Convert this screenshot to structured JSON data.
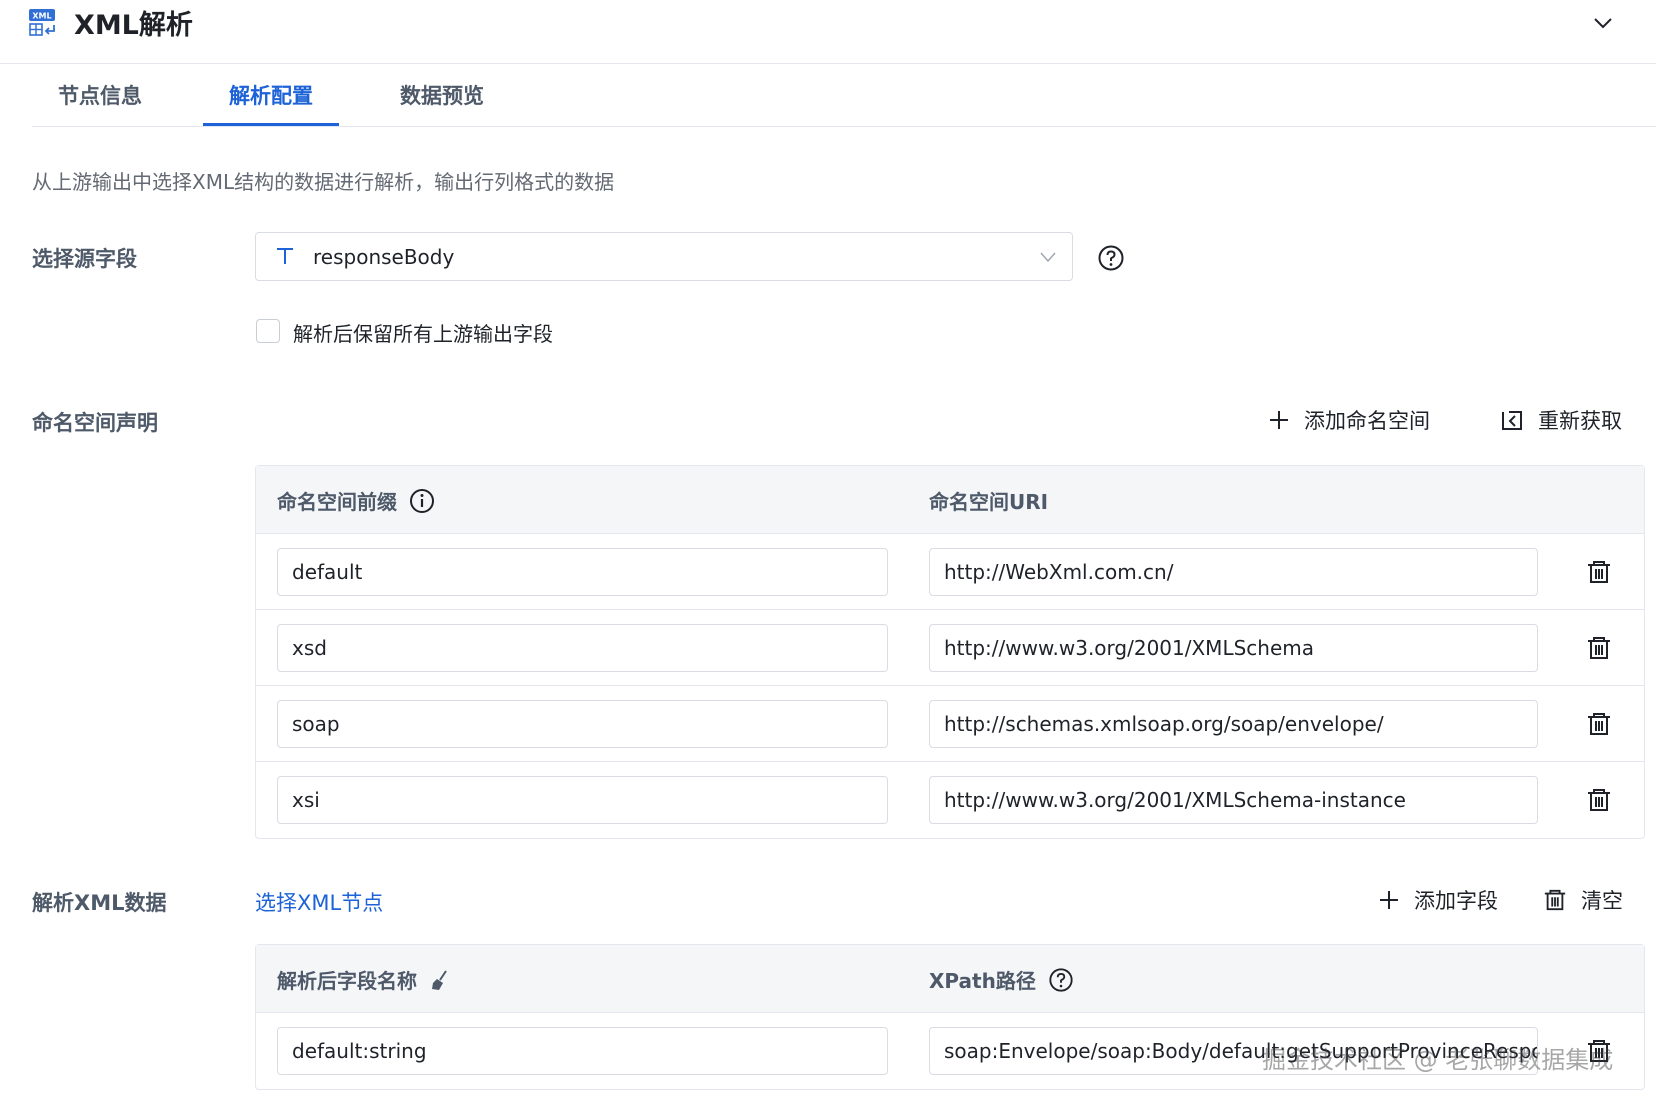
{
  "header": {
    "icon": "xml-icon",
    "icon_text": "XML",
    "title": "XML解析",
    "collapse_icon": "chevron-down-icon"
  },
  "tabs": [
    {
      "label": "节点信息",
      "active": false
    },
    {
      "label": "解析配置",
      "active": true
    },
    {
      "label": "数据预览",
      "active": false
    }
  ],
  "description": "从上游输出中选择XML结构的数据进行解析，输出行列格式的数据",
  "source_field": {
    "label": "选择源字段",
    "type_icon": "text-type-icon",
    "value": "responseBody",
    "help_icon": "question-circle-icon"
  },
  "keep_fields": {
    "checked": false,
    "label": "解析后保留所有上游输出字段"
  },
  "namespace": {
    "label": "命名空间声明",
    "add_label": "添加命名空间",
    "refresh_label": "重新获取",
    "col_prefix": "命名空间前缀",
    "col_uri": "命名空间URI",
    "rows": [
      {
        "prefix": "default",
        "uri": "http://WebXml.com.cn/"
      },
      {
        "prefix": "xsd",
        "uri": "http://www.w3.org/2001/XMLSchema"
      },
      {
        "prefix": "soap",
        "uri": "http://schemas.xmlsoap.org/soap/envelope/"
      },
      {
        "prefix": "xsi",
        "uri": "http://www.w3.org/2001/XMLSchema-instance"
      }
    ]
  },
  "parse": {
    "label": "解析XML数据",
    "select_node_link": "选择XML节点",
    "add_field_label": "添加字段",
    "clear_label": "清空",
    "col_name": "解析后字段名称",
    "col_xpath": "XPath路径",
    "rows": [
      {
        "name": "default:string",
        "xpath": "soap:Envelope/soap:Body/default:getSupportProvinceResponse/default:"
      }
    ]
  },
  "watermark": "掘金技术社区 @ 老张聊数据集成",
  "colors": {
    "accent": "#1d63d7",
    "text": "#1f2329",
    "muted": "#4e5969",
    "border": "#e4e7ed",
    "header_bg": "#f5f6f8"
  }
}
